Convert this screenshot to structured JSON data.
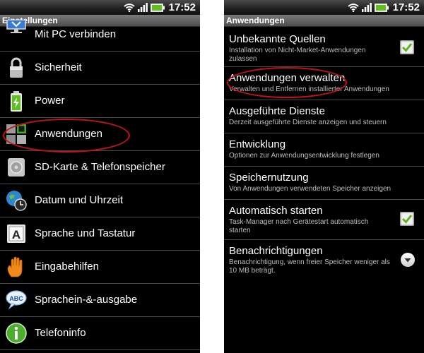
{
  "status": {
    "time": "17:52"
  },
  "left": {
    "title": "Einstellungen",
    "items": [
      {
        "label": "Mit PC verbinden",
        "icon": "pc-connect-icon"
      },
      {
        "label": "Sicherheit",
        "icon": "lock-icon"
      },
      {
        "label": "Power",
        "icon": "battery-icon"
      },
      {
        "label": "Anwendungen",
        "icon": "apps-grid-icon"
      },
      {
        "label": "SD-Karte & Telefonspeicher",
        "icon": "sd-card-icon"
      },
      {
        "label": "Datum und Uhrzeit",
        "icon": "globe-clock-icon"
      },
      {
        "label": "Sprache und Tastatur",
        "icon": "keyboard-key-icon"
      },
      {
        "label": "Eingabehilfen",
        "icon": "hand-icon"
      },
      {
        "label": "Sprachein-&-ausgabe",
        "icon": "speech-bubble-icon"
      },
      {
        "label": "Telefoninfo",
        "icon": "info-icon"
      }
    ]
  },
  "right": {
    "title": "Anwendungen",
    "items": [
      {
        "title": "Unbekannte Quellen",
        "subtitle": "Installation von Nicht-Market-Anwendungen zulassen",
        "control": "checkbox",
        "checked": true
      },
      {
        "title": "Anwendungen verwalten",
        "subtitle": "Verwalten und Entfernen installierter Anwendungen",
        "control": "none"
      },
      {
        "title": "Ausgeführte Dienste",
        "subtitle": "Derzeit ausgeführte Dienste anzeigen und steuern",
        "control": "none"
      },
      {
        "title": "Entwicklung",
        "subtitle": "Optionen zur Anwendungsentwicklung festlegen",
        "control": "none"
      },
      {
        "title": "Speichernutzung",
        "subtitle": "Von Anwendungen verwendeten Speicher anzeigen",
        "control": "none"
      },
      {
        "title": "Automatisch starten",
        "subtitle": "Task-Manager nach Gerätestart automatisch starten",
        "control": "checkbox",
        "checked": true
      },
      {
        "title": "Benachrichtigungen",
        "subtitle": "Benachrichtigung, wenn freier Speicher weniger als 10 MB beträgt.",
        "control": "dropdown"
      }
    ]
  },
  "colors": {
    "highlight_ellipse": "#c8101a",
    "check": "#5fb41f",
    "battery": "#5fbf1c"
  }
}
